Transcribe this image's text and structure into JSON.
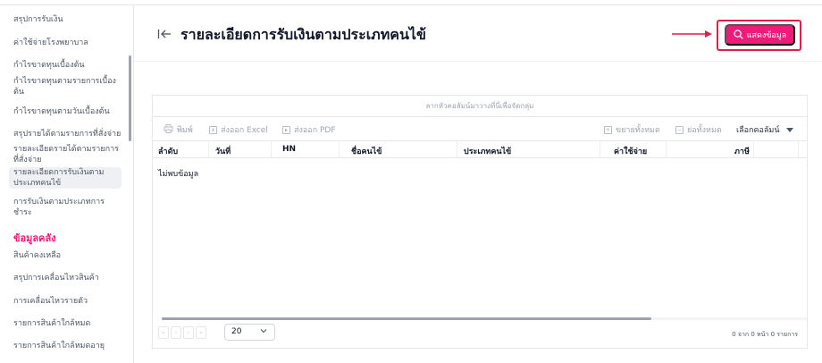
{
  "sidebar": {
    "items": [
      {
        "label": "สรุปการรับเงิน"
      },
      {
        "label": "ค่าใช้จ่ายโรงพยาบาล"
      },
      {
        "label": "กำไรขาดทุนเบื้องต้น"
      },
      {
        "label": "กำไรขาดทุนตามรายการเบื้องต้น"
      },
      {
        "label": "กำไรขาดทุนตามวันเบื้องต้น"
      },
      {
        "label": "สรุปรายได้ตามรายการที่สั่งจ่าย"
      },
      {
        "label": "รายละเอียดรายได้ตามรายการที่สั่งจ่าย"
      },
      {
        "label": "รายละเอียดการรับเงินตามประเภทคนไข้"
      },
      {
        "label": "การรับเงินตามประเภทการชำระ"
      }
    ],
    "section_heading": "ข้อมูลคลัง",
    "stock_items": [
      {
        "label": "สินค้าคงเหลือ"
      },
      {
        "label": "สรุปการเคลื่อนไหวสินค้า"
      },
      {
        "label": "การเคลื่อนไหวรายตัว"
      },
      {
        "label": "รายการสินค้าใกล้หมด"
      },
      {
        "label": "รายการสินค้าใกล้หมดอายุ"
      }
    ]
  },
  "header": {
    "back_icon": "collapse-left-icon",
    "title": "รายละเอียดการรับเงินตามประเภทคนไข้",
    "show_button_label": "แสดงข้อมูล",
    "show_button_icon": "search-icon",
    "accent_color": "#ec1c78",
    "highlight_color": "#e11d48"
  },
  "grid": {
    "group_hint": "ลากหัวคอลัมน์มาวางที่นี่เพื่อจัดกลุ่ม",
    "toolbar": {
      "print": "พิมพ์",
      "export_excel": "ส่งออก Excel",
      "export_pdf": "ส่งออก PDF",
      "expand_all": "ขยายทั้งหมด",
      "collapse_all": "ย่อทั้งหมด",
      "choose_columns": "เลือกคอลัมน์"
    },
    "columns": [
      "ลำดับ",
      "วันที่",
      "HN",
      "ชื่อคนไข้",
      "ประเภทคนไข้",
      "ค่าใช้จ่าย",
      "ภาษี"
    ],
    "empty_text": "ไม่พบข้อมูล",
    "pagination": {
      "page_size": "20",
      "info": "0 จาก 0 หน้า 0 รายการ"
    }
  }
}
